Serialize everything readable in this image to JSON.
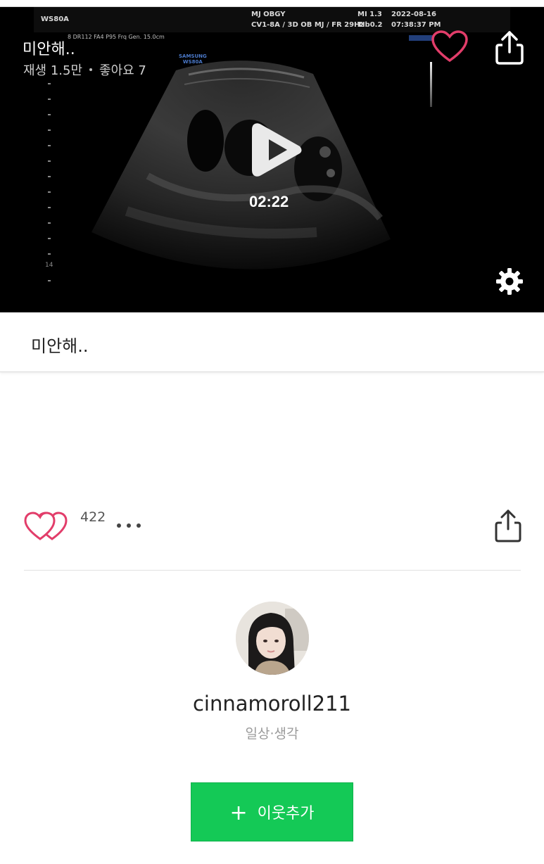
{
  "video": {
    "title": "미안해..",
    "views": "재생 1.5만",
    "likes": "좋아요 7",
    "duration": "02:22",
    "ultrasound": {
      "device": "WS80A",
      "params": "8 DR112 FA4 P95 Frq Gen. 15.0cm",
      "clinic": "MJ OBGY",
      "probe": "CV1-8A / 3D OB MJ / FR 29Hz",
      "mi": "MI  1.3",
      "tib": "TIb0.2",
      "date": "2022-08-16",
      "time": "07:38:37 PM",
      "brand": "SAMSUNG",
      "brand_model": "WS80A",
      "depth_label": "14"
    }
  },
  "post": {
    "caption": "미안해.."
  },
  "reactions": {
    "like_count": "422"
  },
  "author": {
    "username": "cinnamoroll211",
    "category": "일상·생각"
  },
  "follow_button": {
    "label": "이웃추가",
    "icon": "+"
  },
  "colors": {
    "accent_green": "#14c956",
    "heart_pink": "#e23d6a",
    "video_bg": "#000000"
  }
}
